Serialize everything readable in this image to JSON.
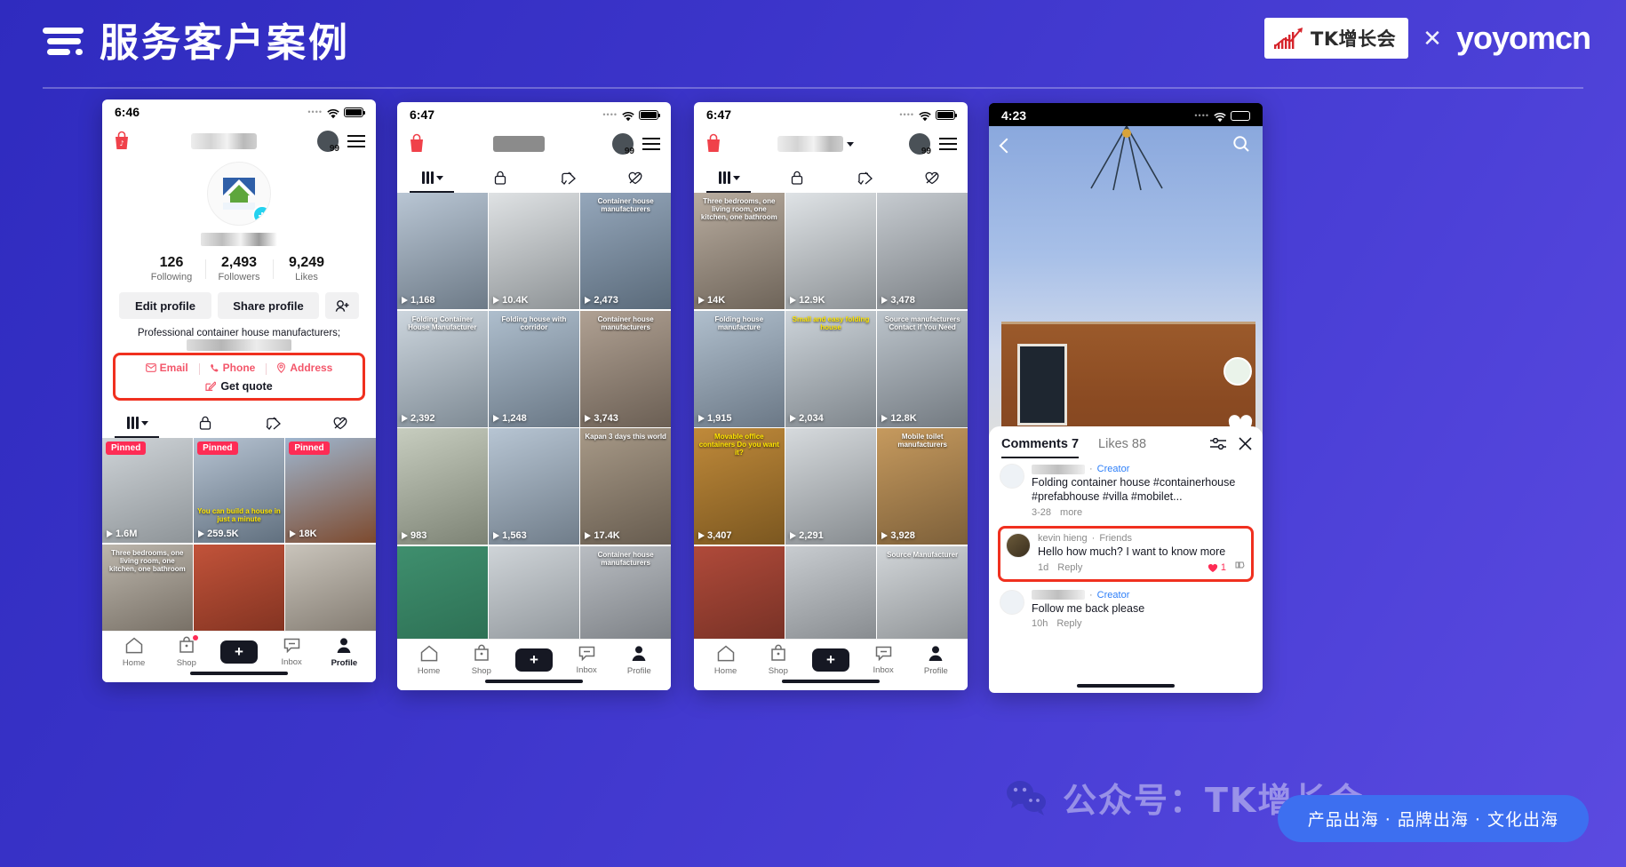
{
  "slide": {
    "title": "服务客户案例",
    "menu_icon": "hamburger-lines-icon",
    "brand_left": "TK增长会",
    "brand_x": "✕",
    "brand_right": "yoyomcn",
    "watermark_text": "公众号：TK增长会",
    "watermark_icon": "wechat-icon",
    "pill_text": "产品出海 · 品牌出海 · 文化出海",
    "accent_red": "#f0301f",
    "tiktok_pink": "#fe2c55",
    "tiktok_cyan": "#25f4ee",
    "bg_blue": "#3b34c9"
  },
  "phone1": {
    "status": {
      "time": "6:46",
      "dots": "••••",
      "wifi": "wifi-icon",
      "battery": "battery-full-icon"
    },
    "header": {
      "shop_icon": "tiktok-shop-bag-icon",
      "badge_count": "99",
      "menu_icon": "hamburger-icon"
    },
    "profile": {
      "avatar_icon": "profile-avatar-image",
      "add_badge": "+",
      "stats": [
        {
          "value": "126",
          "label": "Following"
        },
        {
          "value": "2,493",
          "label": "Followers"
        },
        {
          "value": "9,249",
          "label": "Likes"
        }
      ],
      "edit_button": "Edit profile",
      "share_button": "Share profile",
      "add_friend_icon": "add-person-icon",
      "bio": "Professional container house manufacturers;"
    },
    "contact": {
      "email": "Email",
      "email_icon": "envelope-icon",
      "phone": "Phone",
      "phone_icon": "phone-handset-icon",
      "address": "Address",
      "address_icon": "location-pin-icon",
      "quote": "Get quote",
      "quote_icon": "edit-square-icon"
    },
    "tabs": [
      {
        "name": "grid",
        "icon": "grid-bars-icon"
      },
      {
        "name": "private",
        "icon": "lock-icon"
      },
      {
        "name": "reposts",
        "icon": "repost-icon"
      },
      {
        "name": "liked",
        "icon": "heart-icon"
      }
    ],
    "grid": [
      {
        "views": "1.6M",
        "pinned": "Pinned",
        "caption": "",
        "c1": "#cfd4d8",
        "c2": "#8e9498"
      },
      {
        "views": "259.5K",
        "pinned": "Pinned",
        "caption": "You can build a house in just a minute",
        "caption_color": "yellow",
        "c1": "#b6c3d2",
        "c2": "#61707f"
      },
      {
        "views": "18K",
        "pinned": "Pinned",
        "caption": "",
        "c1": "#9fb6cf",
        "c2": "#7d4a2e"
      },
      {
        "views": "",
        "pinned": "",
        "caption": "Three bedrooms, one living room, one kitchen, one bathroom",
        "c1": "#bcb6ac",
        "c2": "#6e665c"
      },
      {
        "views": "",
        "pinned": "",
        "caption": "",
        "c1": "#c2533a",
        "c2": "#7a2f1e"
      },
      {
        "views": "",
        "pinned": "",
        "caption": "",
        "c1": "#c9c4bb",
        "c2": "#7a7268"
      }
    ],
    "nav": [
      {
        "label": "Home",
        "icon": "home-icon",
        "dot": false,
        "active": false
      },
      {
        "label": "Shop",
        "icon": "shop-bag-icon",
        "dot": true,
        "active": false
      },
      {
        "label": "",
        "icon": "create-plus-button",
        "dot": false,
        "active": false
      },
      {
        "label": "Inbox",
        "icon": "inbox-icon",
        "dot": false,
        "active": false
      },
      {
        "label": "Profile",
        "icon": "person-icon",
        "dot": false,
        "active": true
      }
    ]
  },
  "phone2": {
    "status": {
      "time": "6:47"
    },
    "header": {
      "badge_count": "99"
    },
    "grid": [
      {
        "views": "1,168",
        "caption": "",
        "c1": "#b9c6d4",
        "c2": "#6d7a87"
      },
      {
        "views": "10.4K",
        "caption": "",
        "c1": "#dfe2e4",
        "c2": "#8e9396"
      },
      {
        "views": "2,473",
        "caption": "Container house manufacturers",
        "c1": "#95a7bb",
        "c2": "#5a6a7a"
      },
      {
        "views": "2,392",
        "caption": "Folding Container House Manufacturer",
        "c1": "#cdd6de",
        "c2": "#7e8a94"
      },
      {
        "views": "1,248",
        "caption": "Folding house with corridor",
        "c1": "#aebecd",
        "c2": "#6a7886"
      },
      {
        "views": "3,743",
        "caption": "Container house manufacturers",
        "c1": "#b0a193",
        "c2": "#6b5f54"
      },
      {
        "views": "983",
        "caption": "",
        "c1": "#c7cdbf",
        "c2": "#7d8375"
      },
      {
        "views": "1,563",
        "caption": "",
        "c1": "#b7c5d3",
        "c2": "#707d8a"
      },
      {
        "views": "17.4K",
        "caption": "Kapan 3 days this world",
        "c1": "#a89a88",
        "c2": "#675c4f"
      },
      {
        "views": "",
        "caption": "",
        "c1": "#3f8f6e",
        "c2": "#2a6b50"
      },
      {
        "views": "",
        "caption": "",
        "c1": "#cfd4d8",
        "c2": "#878d92"
      },
      {
        "views": "",
        "caption": "Container house manufacturers",
        "c1": "#b9bdc2",
        "c2": "#72767b"
      }
    ],
    "nav": [
      {
        "label": "Home"
      },
      {
        "label": "Shop"
      },
      {
        "label": ""
      },
      {
        "label": "Inbox"
      },
      {
        "label": "Profile"
      }
    ]
  },
  "phone3": {
    "status": {
      "time": "6:47"
    },
    "header": {
      "badge_count": "99",
      "chevron": "chevron-down-icon"
    },
    "grid": [
      {
        "views": "14K",
        "caption": "Three bedrooms, one living room, one kitchen, one bathroom",
        "c1": "#b9ada0",
        "c2": "#6e6459"
      },
      {
        "views": "12.9K",
        "caption": "",
        "c1": "#dfe3e6",
        "c2": "#8d9296"
      },
      {
        "views": "3,478",
        "caption": "",
        "c1": "#c6cbd0",
        "c2": "#7b8085"
      },
      {
        "views": "1,915",
        "caption": "Folding house manufacture",
        "c1": "#b0bfcd",
        "c2": "#6b7886"
      },
      {
        "views": "2,034",
        "caption": "Small and easy folding house",
        "caption_color": "yellow",
        "c1": "#cdd4da",
        "c2": "#7f868c"
      },
      {
        "views": "12.8K",
        "caption": "Source manufacturers Contact if You Need",
        "c1": "#bcc4cb",
        "c2": "#737a81"
      },
      {
        "views": "3,407",
        "caption": "Movable office containers Do you want it?",
        "caption_color": "yellow",
        "c1": "#c08a3a",
        "c2": "#7b5720"
      },
      {
        "views": "2,291",
        "caption": "",
        "c1": "#d6dadd",
        "c2": "#878c90"
      },
      {
        "views": "3,928",
        "caption": "Mobile toilet manufacturers",
        "c1": "#c69a5e",
        "c2": "#7d603a"
      },
      {
        "views": "",
        "caption": "",
        "c1": "#b04a3a",
        "c2": "#6d2d22"
      },
      {
        "views": "",
        "caption": "",
        "c1": "#c8ccd0",
        "c2": "#7c8084"
      },
      {
        "views": "",
        "caption": "Source Manufacturer",
        "c1": "#d2d6d9",
        "c2": "#84888b"
      }
    ],
    "nav": [
      {
        "label": "Home"
      },
      {
        "label": "Shop"
      },
      {
        "label": ""
      },
      {
        "label": "Inbox"
      },
      {
        "label": "Profile"
      }
    ]
  },
  "phone4": {
    "status": {
      "time": "4:23"
    },
    "video": {
      "back_icon": "chevron-left-icon",
      "search_icon": "search-icon",
      "like_icon": "heart-icon",
      "like_count": "88",
      "brand_badge": "creator-badge-icon"
    },
    "comments_panel": {
      "tab_comments": "Comments 7",
      "tab_likes": "Likes 88",
      "filter_icon": "filter-sliders-icon",
      "close_icon": "close-x-icon",
      "items": [
        {
          "name_blurred": true,
          "badge": "Creator",
          "text": "Folding container house #containerhouse #prefabhouse #villa #mobilet...",
          "more": "more",
          "time": "3-28",
          "highlight": false,
          "reply": "",
          "likes": ""
        },
        {
          "name": "kevin hieng",
          "badge": "Friends",
          "text": "Hello how much? I want to know more",
          "time": "1d",
          "reply": "Reply",
          "likes": "1",
          "highlight": true
        },
        {
          "name_blurred": true,
          "badge": "Creator",
          "text": "Follow me back please",
          "time": "10h",
          "reply": "Reply",
          "likes": "",
          "highlight": false
        }
      ]
    }
  }
}
